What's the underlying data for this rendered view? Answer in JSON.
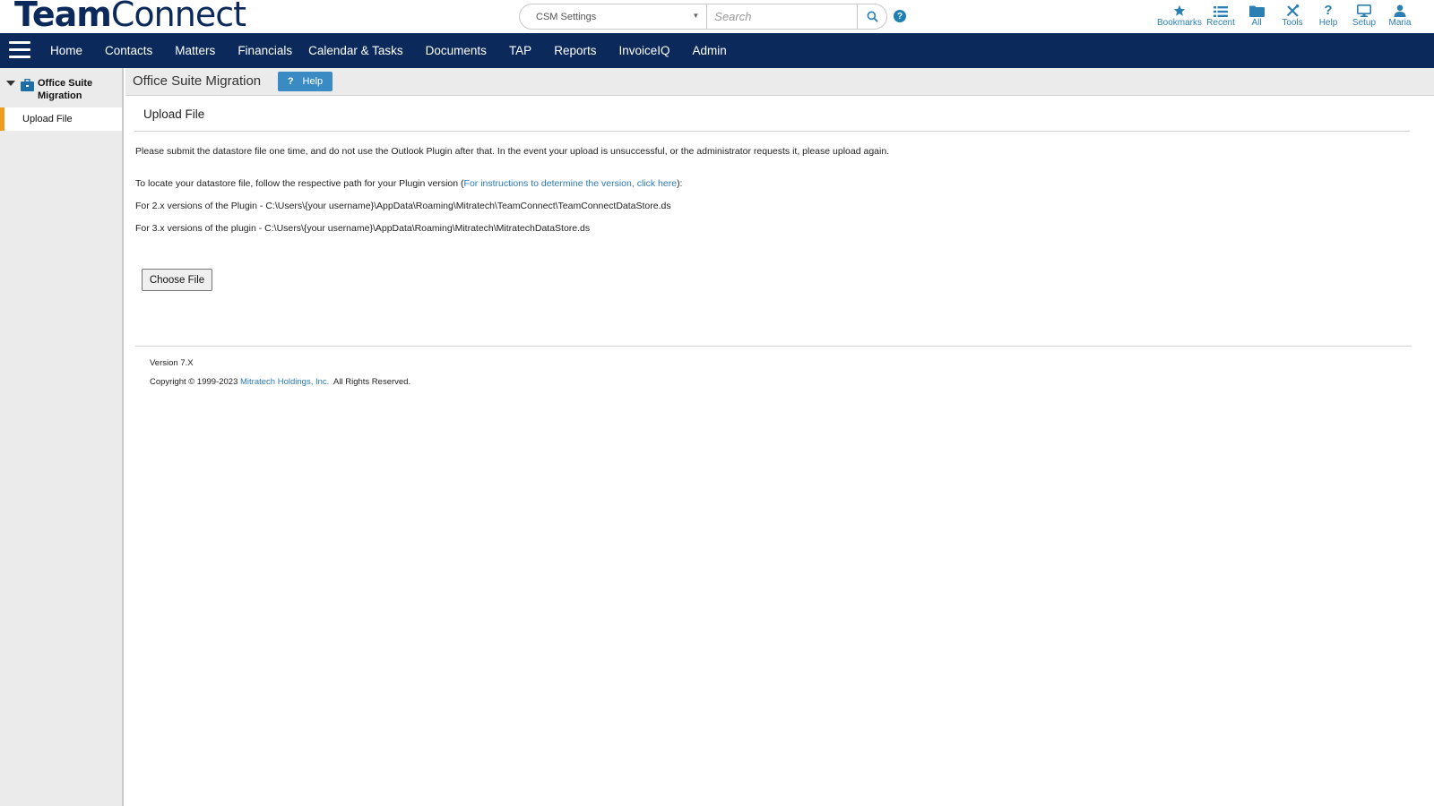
{
  "brand": {
    "part1": "Team",
    "part2": "Connect"
  },
  "search": {
    "scope_value": "CSM Settings",
    "placeholder": "Search"
  },
  "toolbar": {
    "items": [
      {
        "label": "Bookmarks",
        "icon": "star-icon"
      },
      {
        "label": "Recent",
        "icon": "list-icon"
      },
      {
        "label": "All",
        "icon": "folder-icon"
      },
      {
        "label": "Tools",
        "icon": "tools-icon"
      },
      {
        "label": "Help",
        "icon": "question-icon"
      },
      {
        "label": "Setup",
        "icon": "monitor-icon"
      },
      {
        "label": "Maria",
        "icon": "user-icon"
      }
    ]
  },
  "nav": {
    "items": [
      "Home",
      "Contacts",
      "Matters",
      "Financials",
      "Calendar & Tasks",
      "Documents",
      "TAP",
      "Reports",
      "InvoiceIQ",
      "Admin"
    ]
  },
  "sidebar": {
    "group_title": "Office Suite Migration",
    "items": [
      {
        "label": "Upload File"
      }
    ]
  },
  "page": {
    "title": "Office Suite Migration",
    "help_label": "Help",
    "section_title": "Upload File",
    "para1": "Please submit the datastore file one time, and do not use the Outlook Plugin after that. In the event your upload is unsuccessful, or the administrator requests it, please upload again.",
    "para2_prefix": "To locate your datastore file, follow the respective path for your Plugin version (",
    "para2_link": "For instructions to determine the version, click here",
    "para2_suffix": "):",
    "para3": "For 2.x versions of the Plugin - C:\\Users\\{your username}\\AppData\\Roaming\\Mitratech\\TeamConnect\\TeamConnectDataStore.ds",
    "para4": "For 3.x versions of the plugin - C:\\Users\\{your username}\\AppData\\Roaming\\Mitratech\\MitratechDataStore.ds",
    "choose_file_label": "Choose File"
  },
  "footer": {
    "version": "Version 7.X",
    "copyright_prefix": "Copyright © 1999-2023 ",
    "company_link": "Mitratech Holdings, Inc.",
    "copyright_suffix": "  All Rights Reserved."
  },
  "colors": {
    "nav_bg": "#0b2a5b",
    "accent": "#2c7fb3",
    "sidebar_active": "#f29c1f",
    "help_button": "#3a8ac4"
  }
}
